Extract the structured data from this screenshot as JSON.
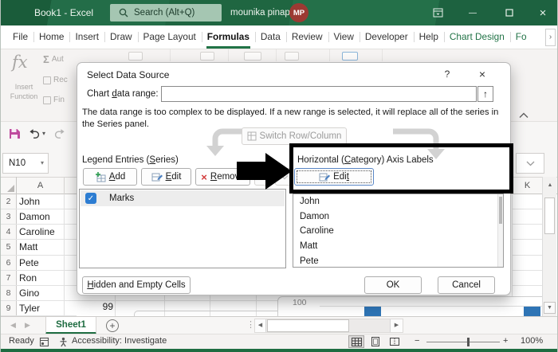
{
  "titlebar": {
    "title": "Book1 - Excel",
    "search_placeholder": "Search (Alt+Q)",
    "user_name": "mounika pinapala",
    "avatar_initials": "MP"
  },
  "menu": {
    "tabs": [
      {
        "label": "File"
      },
      {
        "label": "Home"
      },
      {
        "label": "Insert"
      },
      {
        "label": "Draw"
      },
      {
        "label": "Page Layout"
      },
      {
        "label": "Formulas"
      },
      {
        "label": "Data"
      },
      {
        "label": "Review"
      },
      {
        "label": "View"
      },
      {
        "label": "Developer"
      },
      {
        "label": "Help"
      },
      {
        "label": "Chart Design"
      },
      {
        "label": "Fo"
      }
    ]
  },
  "ribbon": {
    "fx": "fx",
    "insert_function": "Insert Function",
    "autosum": "Aut",
    "recently_used": "Rec",
    "financial": "Fin"
  },
  "formula_bar": {
    "name_box": "N10"
  },
  "dialog": {
    "title": "Select Data Source",
    "range_label": [
      "Chart ",
      "d",
      "ata range:"
    ],
    "range_value": "",
    "message": "The data range is too complex to be displayed. If a new range is selected, it will replace all of the series in the Series panel.",
    "switch_button": "Switch Row/Column",
    "legend": {
      "label": [
        "Legend Entries (",
        "S",
        "eries)"
      ],
      "add": [
        "",
        "A",
        "dd"
      ],
      "edit": [
        "",
        "E",
        "dit"
      ],
      "remove": [
        "",
        "R",
        "emove"
      ],
      "items": [
        {
          "label": "Marks",
          "checked": true
        }
      ]
    },
    "horizontal": {
      "label": [
        "Horizontal (",
        "C",
        "ategory) Axis Labels"
      ],
      "edit": [
        "Edi",
        "t",
        ""
      ],
      "items": [
        "John",
        "Damon",
        "Caroline",
        "Matt",
        "Pete"
      ]
    },
    "hidden_button": [
      "",
      "H",
      "idden and Empty Cells"
    ],
    "ok": "OK",
    "cancel": "Cancel"
  },
  "sheet": {
    "col_a": "A",
    "col_k": "K",
    "rows": [
      {
        "num": "2",
        "name": "John"
      },
      {
        "num": "3",
        "name": "Damon"
      },
      {
        "num": "4",
        "name": "Caroline"
      },
      {
        "num": "5",
        "name": "Matt"
      },
      {
        "num": "6",
        "name": "Pete"
      },
      {
        "num": "7",
        "name": "Ron"
      },
      {
        "num": "8",
        "name": "Gino"
      },
      {
        "num": "9",
        "name": "Tyler"
      }
    ],
    "b9_value": "99",
    "chart_fragment": {
      "axis_label": "100",
      "bar_color": "#2e74b5"
    }
  },
  "tab_bar": {
    "sheet_name": "Sheet1"
  },
  "status_bar": {
    "mode": "Ready",
    "accessibility": "Accessibility: Investigate",
    "zoom_level": "100%"
  },
  "icons": {
    "close": "×",
    "minimize": "—",
    "help": "?",
    "sigma": "Σ",
    "dropdown": "▾",
    "up_arrow": "↑",
    "check": "✓",
    "ellipsis_v": "⋮",
    "left_tri": "◀",
    "right_tri": "▶",
    "up_tri": "▲",
    "down_tri": "▼",
    "plus": "+",
    "more": "›",
    "minus": "−",
    "zoom_plus": "+"
  },
  "colors": {
    "excel_green": "#217346",
    "annotation": "#000000",
    "checkbox_blue": "#2d7dd2",
    "bar_blue": "#2e74b5"
  }
}
